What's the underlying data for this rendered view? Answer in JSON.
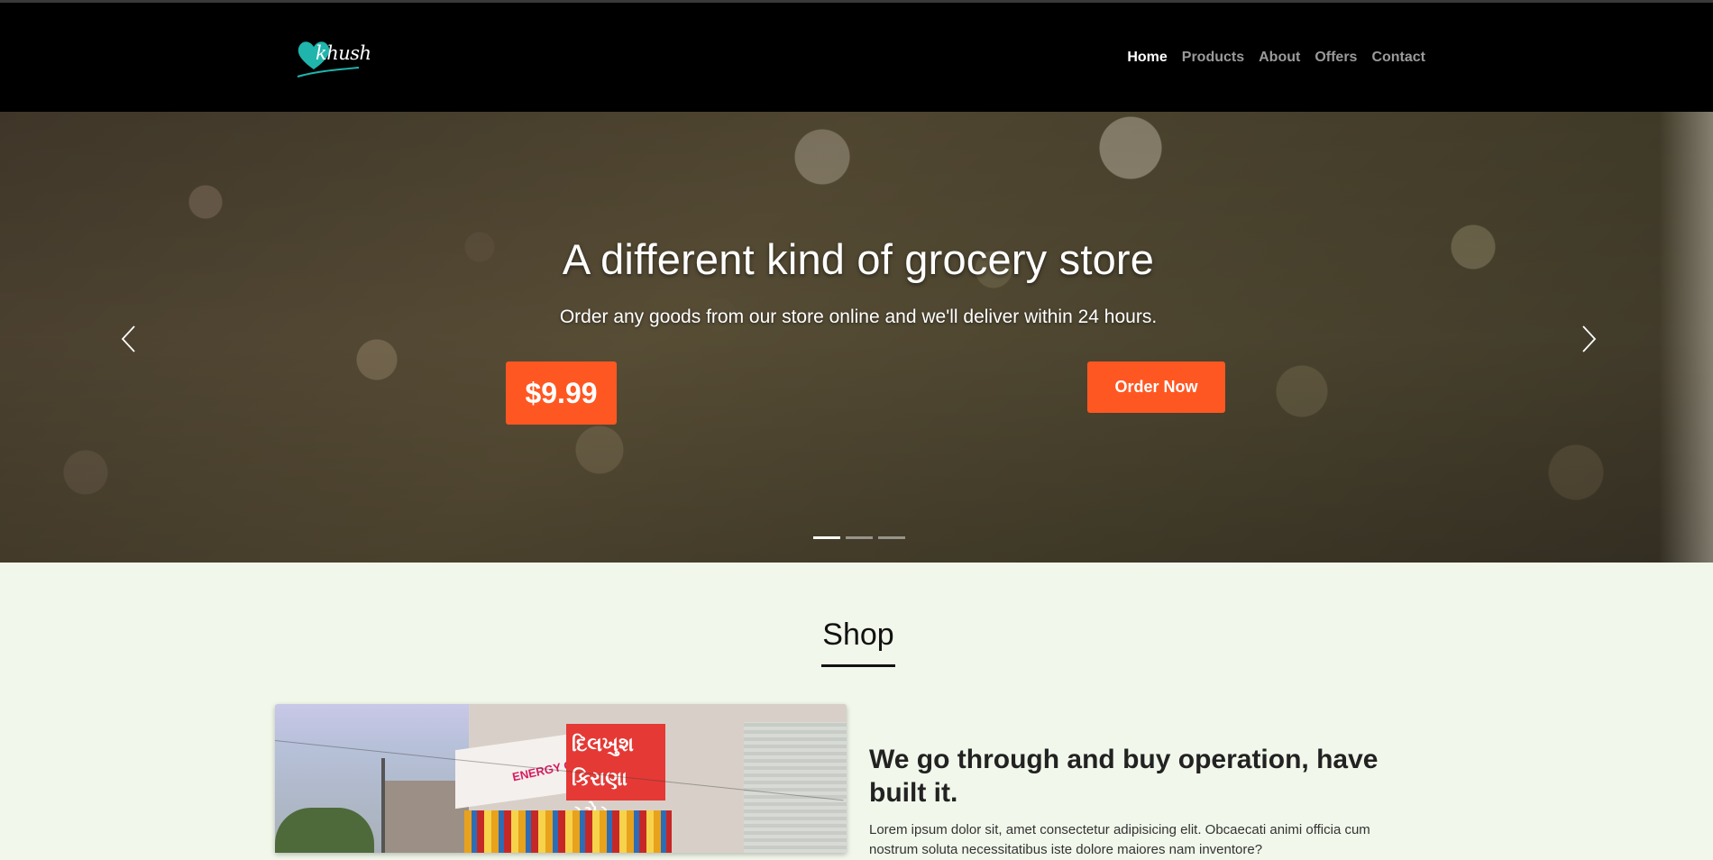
{
  "brand": {
    "name": "khush",
    "logo_icon": "heart-logo",
    "accent": "#1fb5ad"
  },
  "nav": {
    "items": [
      {
        "label": "Home",
        "active": true
      },
      {
        "label": "Products",
        "active": false
      },
      {
        "label": "About",
        "active": false
      },
      {
        "label": "Offers",
        "active": false
      },
      {
        "label": "Contact",
        "active": false
      }
    ]
  },
  "hero": {
    "title": "A different kind of grocery store",
    "subtitle": "Order any goods from our store online and we'll deliver within 24 hours.",
    "price": "$9.99",
    "cta_label": "Order Now",
    "accent_color": "#ff5722",
    "slide_count": 3,
    "active_slide": 1,
    "prev_icon": "chevron-left-icon",
    "next_icon": "chevron-right-icon"
  },
  "shop": {
    "title": "Shop",
    "photo": {
      "sign_text": "દિલખુશ કિરાણા સ્ટોર",
      "banner_text": "ENERGY ON THE GO"
    },
    "heading": "We go through and buy operation, have built it.",
    "body": "Lorem ipsum dolor sit, amet consectetur adipisicing elit. Obcaecati animi officia cum nostrum soluta necessitatibus iste dolore maiores nam inventore?"
  }
}
